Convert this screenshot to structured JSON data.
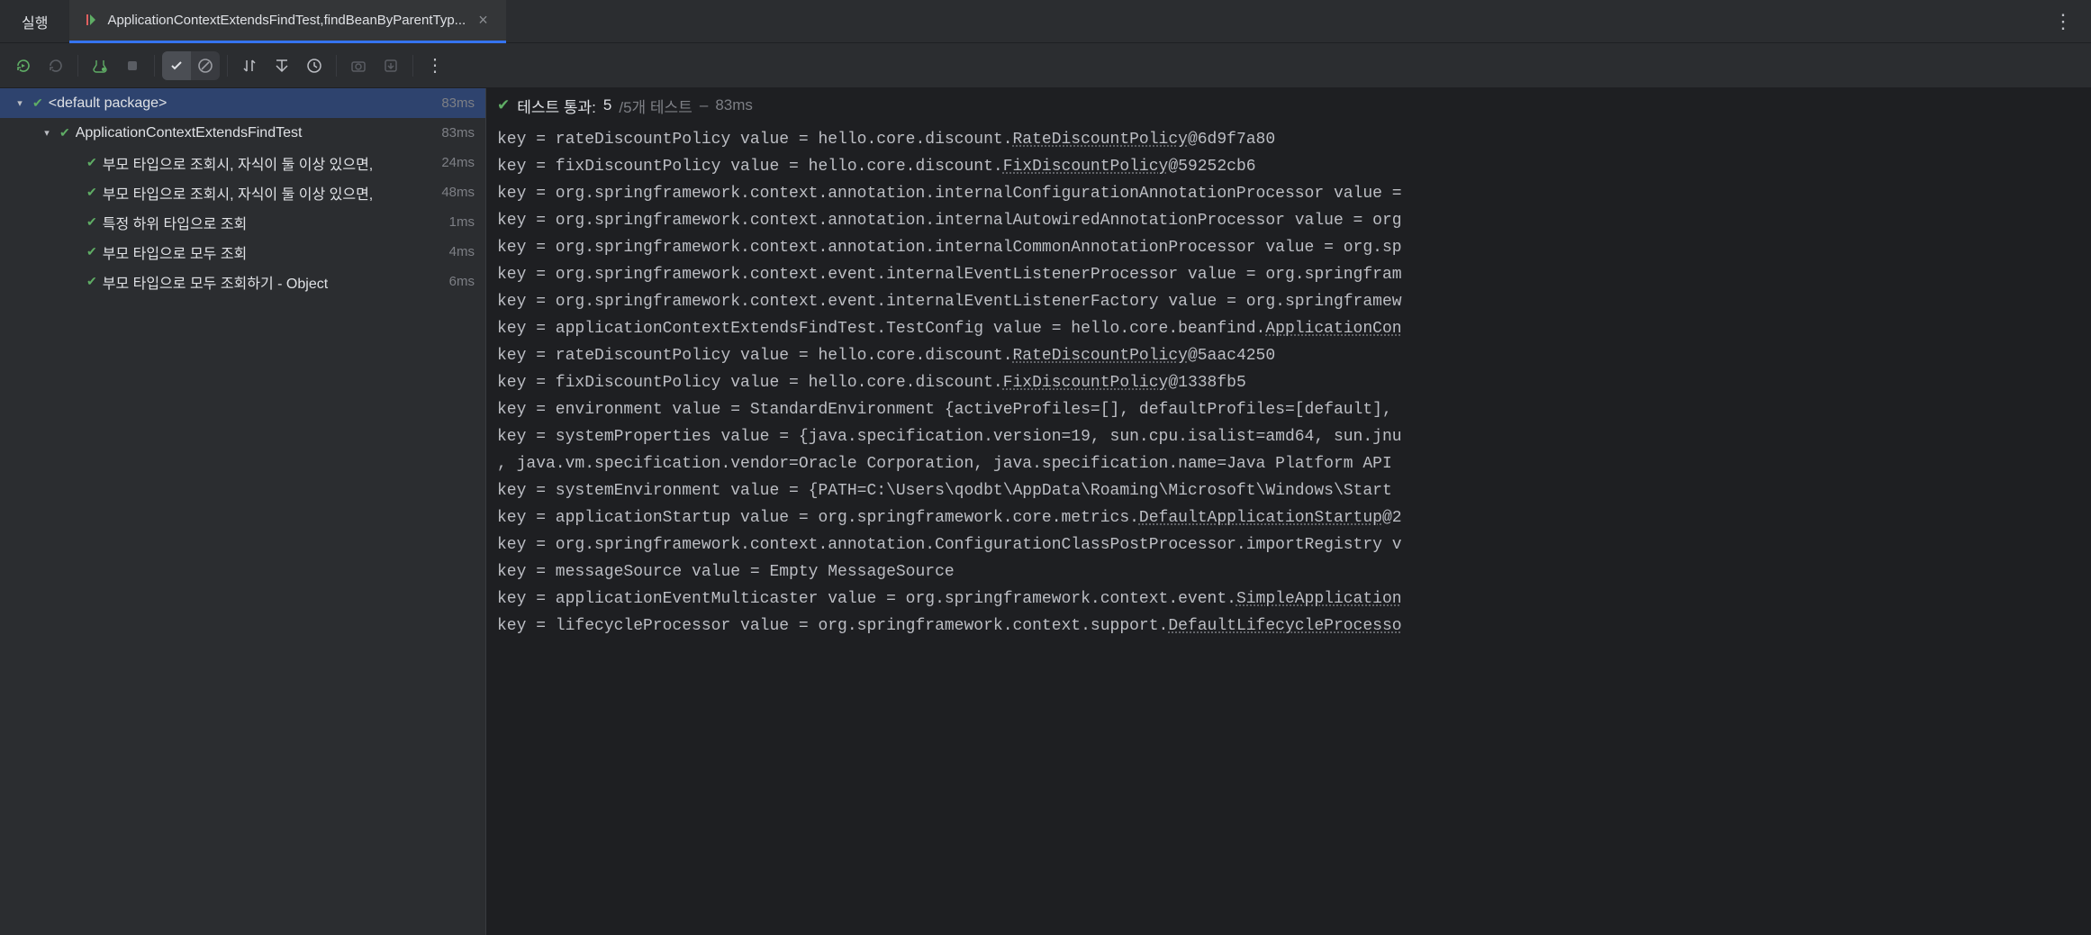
{
  "header": {
    "run_label": "실행",
    "tab_title": "ApplicationContextExtendsFindTest,findBeanByParentTyp...",
    "kebab": "⋮"
  },
  "tree": {
    "root": {
      "name": "<default package>",
      "time": "83ms"
    },
    "class": {
      "name": "ApplicationContextExtendsFindTest",
      "time": "83ms"
    },
    "tests": [
      {
        "name": "부모 타입으로 조회시, 자식이 둘 이상 있으면,",
        "time": "24ms"
      },
      {
        "name": "부모 타입으로 조회시, 자식이 둘 이상 있으면,",
        "time": "48ms"
      },
      {
        "name": "특정 하위 타입으로 조회",
        "time": "1ms"
      },
      {
        "name": "부모 타입으로 모두 조회",
        "time": "4ms"
      },
      {
        "name": "부모 타입으로 모두 조회하기 - Object",
        "time": "6ms"
      }
    ]
  },
  "console": {
    "status_label": "테스트 통과:",
    "status_count": "5",
    "status_total": "/5개 테스트",
    "status_dash": " – ",
    "status_time": "83ms",
    "lines": [
      "key = rateDiscountPolicy value = hello.core.discount.RateDiscountPolicy@6d9f7a80",
      "key = fixDiscountPolicy value = hello.core.discount.FixDiscountPolicy@59252cb6",
      "key = org.springframework.context.annotation.internalConfigurationAnnotationProcessor value =",
      "key = org.springframework.context.annotation.internalAutowiredAnnotationProcessor value = org",
      "key = org.springframework.context.annotation.internalCommonAnnotationProcessor value = org.sp",
      "key = org.springframework.context.event.internalEventListenerProcessor value = org.springfram",
      "key = org.springframework.context.event.internalEventListenerFactory value = org.springframew",
      "key = applicationContextExtendsFindTest.TestConfig value = hello.core.beanfind.ApplicationCon",
      "key = rateDiscountPolicy value = hello.core.discount.RateDiscountPolicy@5aac4250",
      "key = fixDiscountPolicy value = hello.core.discount.FixDiscountPolicy@1338fb5",
      "key = environment value = StandardEnvironment {activeProfiles=[], defaultProfiles=[default],",
      "key = systemProperties value = {java.specification.version=19, sun.cpu.isalist=amd64, sun.jnu",
      ", java.vm.specification.vendor=Oracle Corporation, java.specification.name=Java Platform API ",
      "key = systemEnvironment value = {PATH=C:\\Users\\qodbt\\AppData\\Roaming\\Microsoft\\Windows\\Start ",
      "key = applicationStartup value = org.springframework.core.metrics.DefaultApplicationStartup@2",
      "key = org.springframework.context.annotation.ConfigurationClassPostProcessor.importRegistry v",
      "key = messageSource value = Empty MessageSource",
      "key = applicationEventMulticaster value = org.springframework.context.event.SimpleApplication",
      "key = lifecycleProcessor value = org.springframework.context.support.DefaultLifecycleProcesso"
    ]
  }
}
